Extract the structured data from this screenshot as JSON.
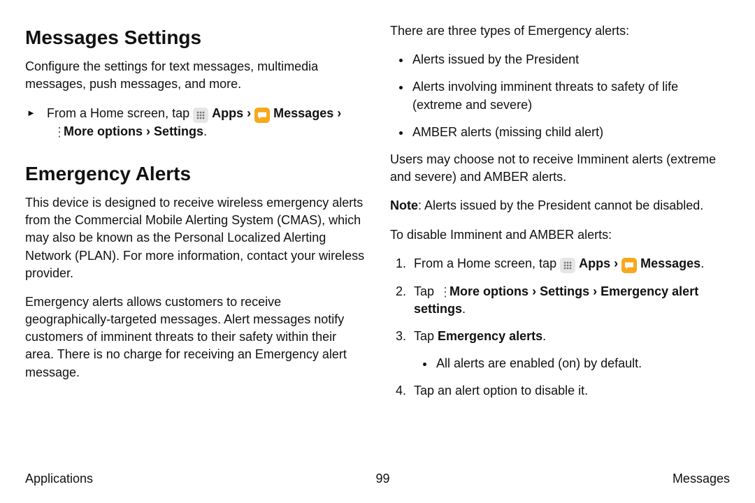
{
  "left": {
    "h1": "Messages Settings",
    "p1": "Configure the settings for text messages, multimedia messages, push messages, and more.",
    "step_prefix": "From a Home screen, tap ",
    "apps": "Apps",
    "messages": "Messages",
    "more_options": "More options",
    "settings": "Settings",
    "h2": "Emergency Alerts",
    "p2": "This device is designed to receive wireless emergency alerts from the Commercial Mobile Alerting System (CMAS), which may also be known as the Personal Localized Alerting Network (PLAN). For more information, contact your wireless provider.",
    "p3": "Emergency alerts allows customers to receive geographically-targeted messages. Alert messages notify customers of imminent threats to their safety within their area. There is no charge for receiving an Emergency alert message."
  },
  "right": {
    "p1": "There are three types of Emergency alerts:",
    "b1": "Alerts issued by the President",
    "b2": "Alerts involving imminent threats to safety of life (extreme and severe)",
    "b3": "AMBER alerts (missing child alert)",
    "p2": "Users may choose not to receive Imminent alerts (extreme and severe) and AMBER alerts.",
    "note_label": "Note",
    "note_body": ": Alerts issued by the President cannot be disabled.",
    "p3": "To disable Imminent and AMBER alerts:",
    "s1_prefix": "From a Home screen, tap ",
    "apps": "Apps",
    "messages": "Messages",
    "s2_prefix": "Tap ",
    "more_options": "More options",
    "settings": "Settings",
    "emerg_settings": "Emergency alert settings",
    "s3_prefix": "Tap ",
    "s3_bold": "Emergency alerts",
    "s3_sub": "All alerts are enabled (on) by default.",
    "s4": "Tap an alert option to disable it."
  },
  "chevron": "›",
  "period": ".",
  "triangle": "►",
  "footer": {
    "left": "Applications",
    "center": "99",
    "right": "Messages"
  }
}
